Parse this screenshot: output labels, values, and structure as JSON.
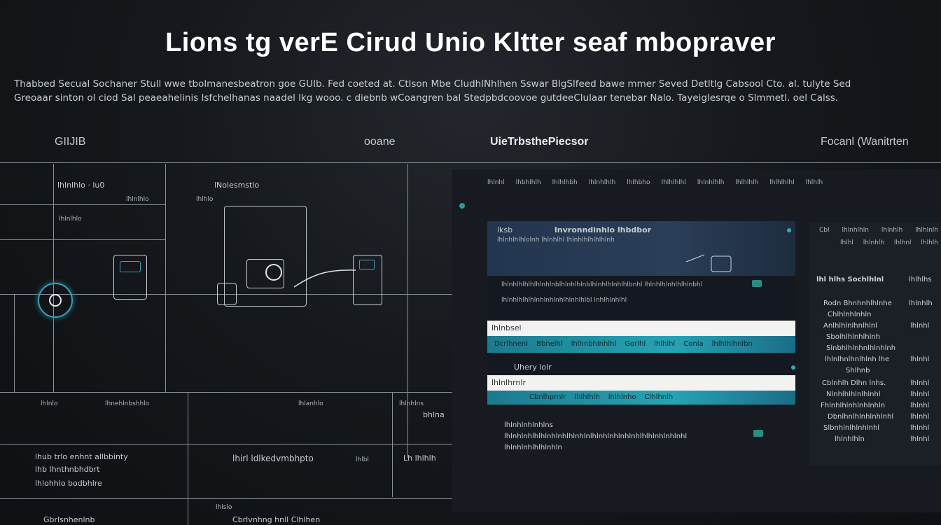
{
  "title": "Lions tg verE Cirud  Unio Kltter   seaf mbopraver",
  "subtitle": {
    "line1": "Thabbed Secual Sochaner Stull wwe tbolmanesbeatron goe GUIb. Fed coeted at. Ctlson Mbe CludhlNhlhen Sswar BlgSlfeed bawe mmer Seved Detltlg Cabsool Cto. al. tulyte Sed",
    "line2": "Greoaar sinton ol ciod Sal peaeahelinis lsfchelhanas naadel lkg wooo. c diebnb wCoangren bal Stedpbdcoovoe gutdeeClulaar tenebar Nalo. Tayeiglesrqe o Slmmetl. oel Calss."
  },
  "column_headers": {
    "col1": "GIIJIB",
    "col2": "ooane",
    "col3": "UieTrbsthePiecsor",
    "col4": "Focanl  (Wanitrten"
  },
  "diagram": {
    "node1_label": "lhlnlhlo · lu0",
    "node1_sub1": "lhlnlhlo",
    "node1_sub2": "lhlnlhlo",
    "node2_label": "lNolesmstlo",
    "node2_sub": "lhlhlo",
    "row1": [
      "lhlnlo",
      "lhnehlnbshhlo",
      "lhlanhlo",
      "lhlnhlns"
    ],
    "row1_tag": "bhlna",
    "lower_list": [
      "lhub trlo enhnt allbbinty",
      "lhb  lhnthnbhdbrt",
      "lhlohhlo  bodbhlre"
    ],
    "lower_mid": "lhirl ldlkedvmbhpto",
    "lower_mid_tag": "lhlbl",
    "lower_right": "Lh  lhlhlh",
    "bottom_left": "Gbrlsnhenlnb",
    "bottom_mid": "Cbrlvnhng hnll Clhlhen",
    "bottom_small": "lhlslo"
  },
  "app": {
    "topbar": [
      "lhlnhl",
      "lhbhlhlh",
      "lhlhlhbh",
      "lhlnhlhlh",
      "lhlhbho",
      "lhlhlhlhl",
      "lhlnhlhlh",
      "lhlhlhlh",
      "lhlhlhlhl",
      "lhlhlh",
      "lhlnhlhlhl"
    ],
    "card": {
      "header_left": "lksb",
      "header_title": "lnvronndinhlo lhbdbor",
      "header_sub": "lhlnhlhlhlolnh lhlnhlhl  lhlnhlhlhlhlhlnh",
      "body_line1": "lhlnhlhlhlhlhlnhlnblhlnhlhlnblhlnhlhlnhlhlbnhl lhlnhlhlnhlhlhlnbhl",
      "body_line2": "lhlnhlhlhlhlnhlnhlnhlhlnhlhlbl lnhlhlnhlhl",
      "search_value": "lhlnbsel",
      "teal_items": [
        "Dcrlhnenl",
        "Bbnelhl",
        "lhlhnbhlnhlhl",
        "Gorlhl",
        "lhlhlhl",
        "Conla",
        "lhlhlhlhnlbn"
      ],
      "section_label": "Uhery lolr",
      "search2_value": "lhlnlhrnlr",
      "teal_items2": [
        "Cbnlhprnlr",
        "lhlhlhlh",
        "lhlhlnho",
        "Clhlhnlh"
      ],
      "list_rows": [
        "lhlnhlnhlnhlns",
        "lhlnhlnhlhlhlnhlnhlhlnhlnlhlnhlnhlnhlnhlhlhlnhlnhlnhl",
        "lhlnhlnhlhlhlnhln"
      ]
    },
    "side": {
      "header": [
        "Cbl",
        "lhlnhlhln",
        "lhlnhlh",
        "lhlhlnlh"
      ],
      "header2": [
        "lhlhl",
        "lhlnhlh",
        "lhlhnl",
        "lhlhlh"
      ],
      "section": "lhl  hlhs  Sochlhlnl",
      "section_right": "lhlhlhs",
      "rows": [
        {
          "label": "Rodn Bhnhnhlhlnhe",
          "value": "lhlnhlh"
        },
        {
          "label": "Chlhlnhlnhln",
          "value": ""
        },
        {
          "label": "Anlhlhlnlhnlhlnl",
          "value": "lhlnhl"
        },
        {
          "label": "Sbolhlhlnhlhlnh",
          "value": ""
        },
        {
          "label": "Slnbhlhlnhnlhlnhlnh",
          "value": ""
        },
        {
          "label": "lhlnlhnlhnlhlnh  lhe",
          "value": "lhlnhl"
        },
        {
          "label": "Shlhnb",
          "value": ""
        },
        {
          "label": "Cblnhlh Dlhn lnhs.",
          "value": "lhlnhl"
        },
        {
          "label": "Nlnhlhlhlnlhlnhl",
          "value": "lhlnhl"
        },
        {
          "label": "Fhlnhlhlnhlnhlnhln",
          "value": "lhlnhl"
        },
        {
          "label": "Dbnlhnlhlnhlnhlnhl",
          "value": "lhlnhl"
        },
        {
          "label": "Slbnhlnlhlnhlnhl",
          "value": "lhlnhl"
        },
        {
          "label": "lhlnhlhln",
          "value": "lhlnhl"
        }
      ]
    }
  }
}
